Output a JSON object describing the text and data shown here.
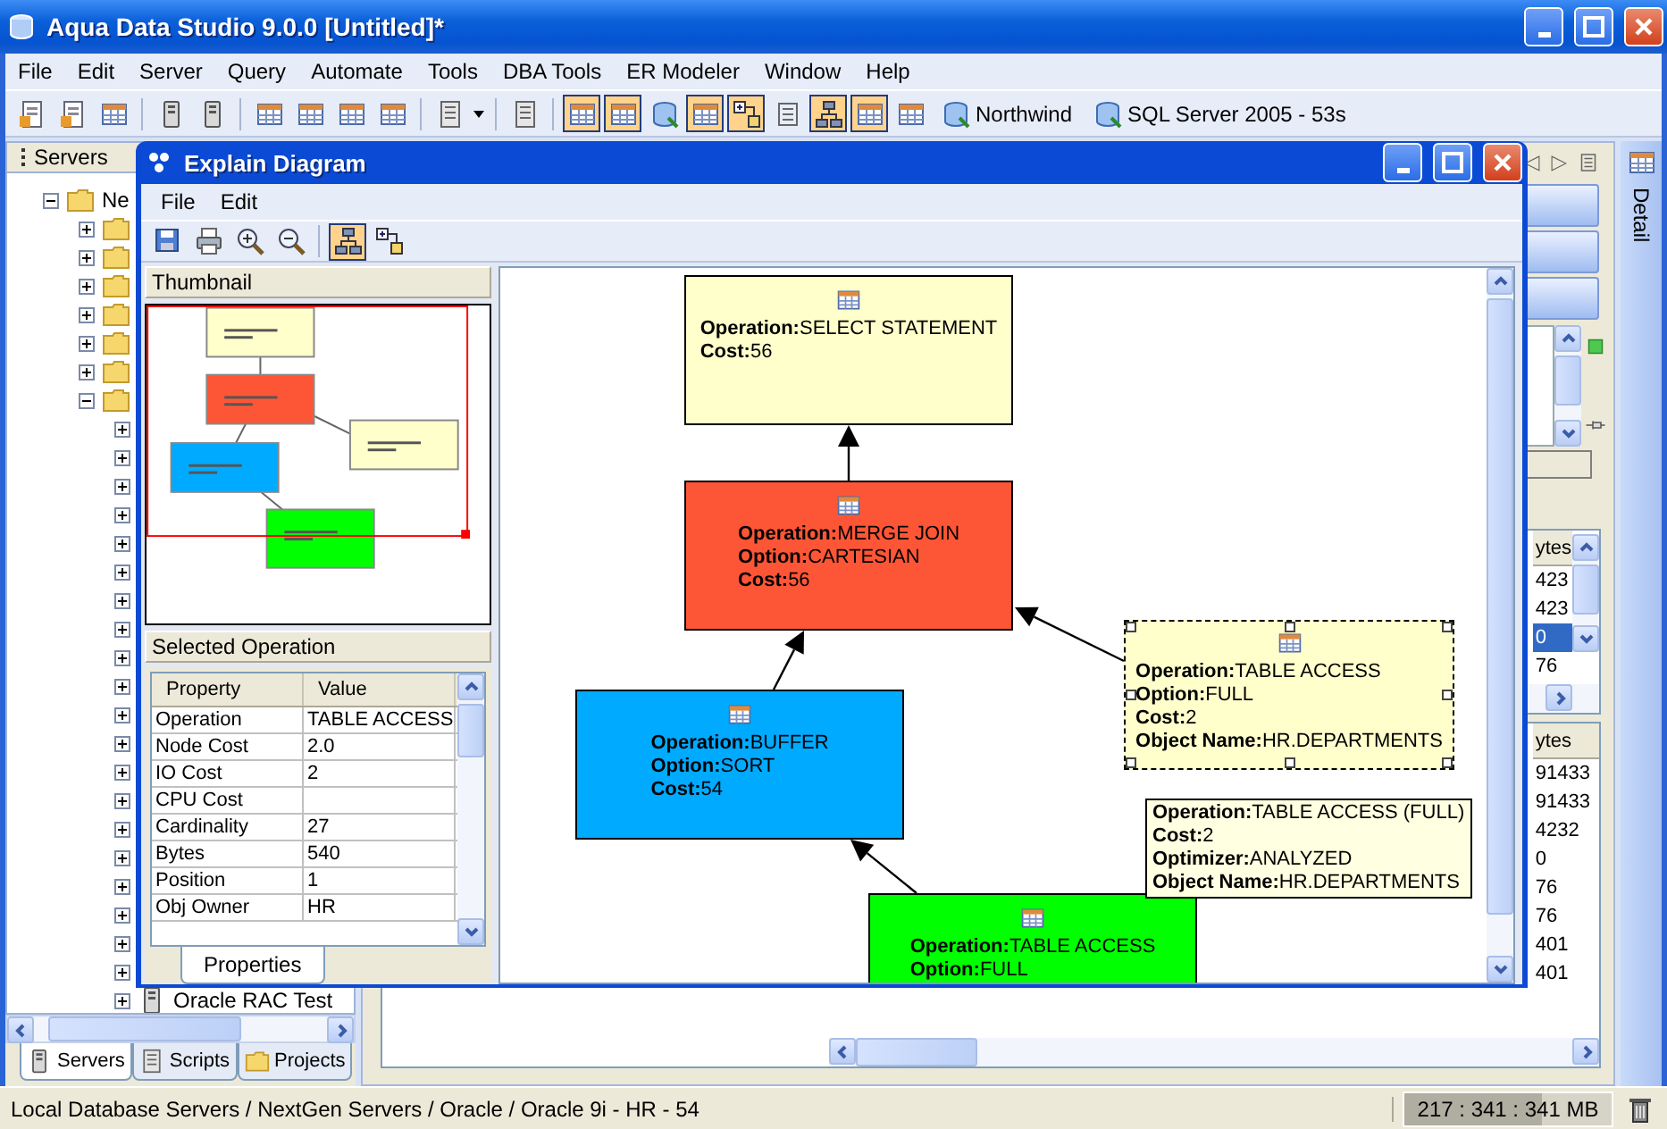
{
  "window": {
    "title": "Aqua Data Studio 9.0.0 [Untitled]*"
  },
  "menu": [
    "File",
    "Edit",
    "Server",
    "Query",
    "Automate",
    "Tools",
    "DBA Tools",
    "ER Modeler",
    "Window",
    "Help"
  ],
  "toolbar": {
    "toggles": [
      {
        "selected": true
      },
      {
        "selected": true
      },
      {
        "selected": false
      },
      {
        "selected": true
      },
      {
        "selected": true
      },
      {
        "selected": false
      },
      {
        "selected": true
      },
      {
        "selected": true
      },
      {
        "selected": false
      }
    ],
    "connections": [
      {
        "label": "Northwind"
      },
      {
        "label": "SQL Server 2005 - 53s"
      }
    ]
  },
  "servers_panel": {
    "title": "Servers",
    "tree": {
      "label": "Ne",
      "expanded": true,
      "children": [
        {
          "expanded": false
        },
        {
          "expanded": false
        },
        {
          "expanded": false
        },
        {
          "expanded": false
        },
        {
          "expanded": false
        },
        {
          "expanded": false
        },
        {
          "expanded": true,
          "children": [
            {
              "expanded": false
            },
            {
              "expanded": false
            },
            {
              "expanded": false
            },
            {
              "expanded": false
            },
            {
              "expanded": false
            },
            {
              "expanded": false
            },
            {
              "expanded": false
            },
            {
              "expanded": false
            },
            {
              "expanded": false
            },
            {
              "expanded": false
            },
            {
              "expanded": false
            },
            {
              "expanded": false
            },
            {
              "expanded": false
            },
            {
              "expanded": false
            },
            {
              "expanded": false
            },
            {
              "expanded": false
            },
            {
              "expanded": false
            },
            {
              "expanded": false
            },
            {
              "expanded": false
            },
            {
              "expanded": false
            },
            {
              "label": "Oracle RAC Test",
              "expanded": false
            }
          ]
        }
      ]
    },
    "tabs": [
      {
        "label": "Servers",
        "selected": true
      },
      {
        "label": "Scripts",
        "selected": false
      },
      {
        "label": "Projects",
        "selected": false
      }
    ]
  },
  "results": {
    "grids": [
      {
        "column": "ytes",
        "rows": [
          {
            "value": "423",
            "selected": false
          },
          {
            "value": "423",
            "selected": false
          },
          {
            "value": "0",
            "selected": true
          },
          {
            "value": "76",
            "selected": false
          }
        ]
      },
      {
        "column": "ytes",
        "rows": [
          {
            "value": "91433",
            "selected": false
          },
          {
            "value": "91433",
            "selected": false
          },
          {
            "value": "4232",
            "selected": false
          },
          {
            "value": "0",
            "selected": false
          },
          {
            "value": "76",
            "selected": false
          },
          {
            "value": "76",
            "selected": false
          },
          {
            "value": "401",
            "selected": false
          },
          {
            "value": "401",
            "selected": false
          }
        ]
      }
    ]
  },
  "detail": {
    "label": "Detail"
  },
  "explain": {
    "title": "Explain Diagram",
    "menu": [
      "File",
      "Edit"
    ],
    "layouts": [
      {
        "selected": true
      },
      {
        "selected": false
      }
    ],
    "thumbnail": {
      "title": "Thumbnail"
    },
    "selected_operation": {
      "title": "Selected Operation",
      "columns": [
        "Property",
        "Value"
      ],
      "rows": [
        {
          "property": "Operation",
          "value": "TABLE ACCESS"
        },
        {
          "property": "Node Cost",
          "value": "2.0"
        },
        {
          "property": "IO Cost",
          "value": "2"
        },
        {
          "property": "CPU Cost"
        },
        {
          "property": "Cardinality",
          "value": "27"
        },
        {
          "property": "Bytes",
          "value": "540"
        },
        {
          "property": "Position",
          "value": "1"
        },
        {
          "property": "Obj Owner",
          "value": "HR"
        }
      ]
    },
    "tabs": [
      {
        "label": "Properties",
        "selected": true
      }
    ],
    "nodes": [
      {
        "color": "#ffffcc",
        "selected": false,
        "lines": [
          "**Operation:**SELECT STATEMENT",
          "**Cost:**56"
        ]
      },
      {
        "color": "#fd5636",
        "selected": false,
        "lines": [
          "**Operation:**MERGE JOIN",
          "**Option:**CARTESIAN",
          "**Cost:**56"
        ]
      },
      {
        "color": "#ffffcc",
        "selected": true,
        "lines": [
          "**Operation:**TABLE ACCESS",
          "**Option:**FULL",
          "**Cost:**2",
          "**Object Name:**HR.DEPARTMENTS"
        ]
      },
      {
        "color": "#00aaff",
        "selected": false,
        "lines": [
          "**Operation:**BUFFER",
          "**Option:**SORT",
          "**Cost:**54"
        ]
      },
      {
        "color": "#00ff00",
        "selected": false,
        "lines": [
          "**Operation:**TABLE ACCESS",
          "**Option:**FULL"
        ]
      }
    ],
    "tooltip": {
      "lines": [
        "**Operation:**TABLE ACCESS (FULL)",
        "**Cost:**2",
        "**Optimizer:**ANALYZED",
        "**Object Name:**HR.DEPARTMENTS"
      ]
    }
  },
  "status_bar": {
    "path": "Local Database Servers / NextGen Servers / Oracle / Oracle 9i - HR - 54",
    "memory": {
      "reading": "217 : 341 : 341 MB",
      "level": 0.66
    }
  }
}
